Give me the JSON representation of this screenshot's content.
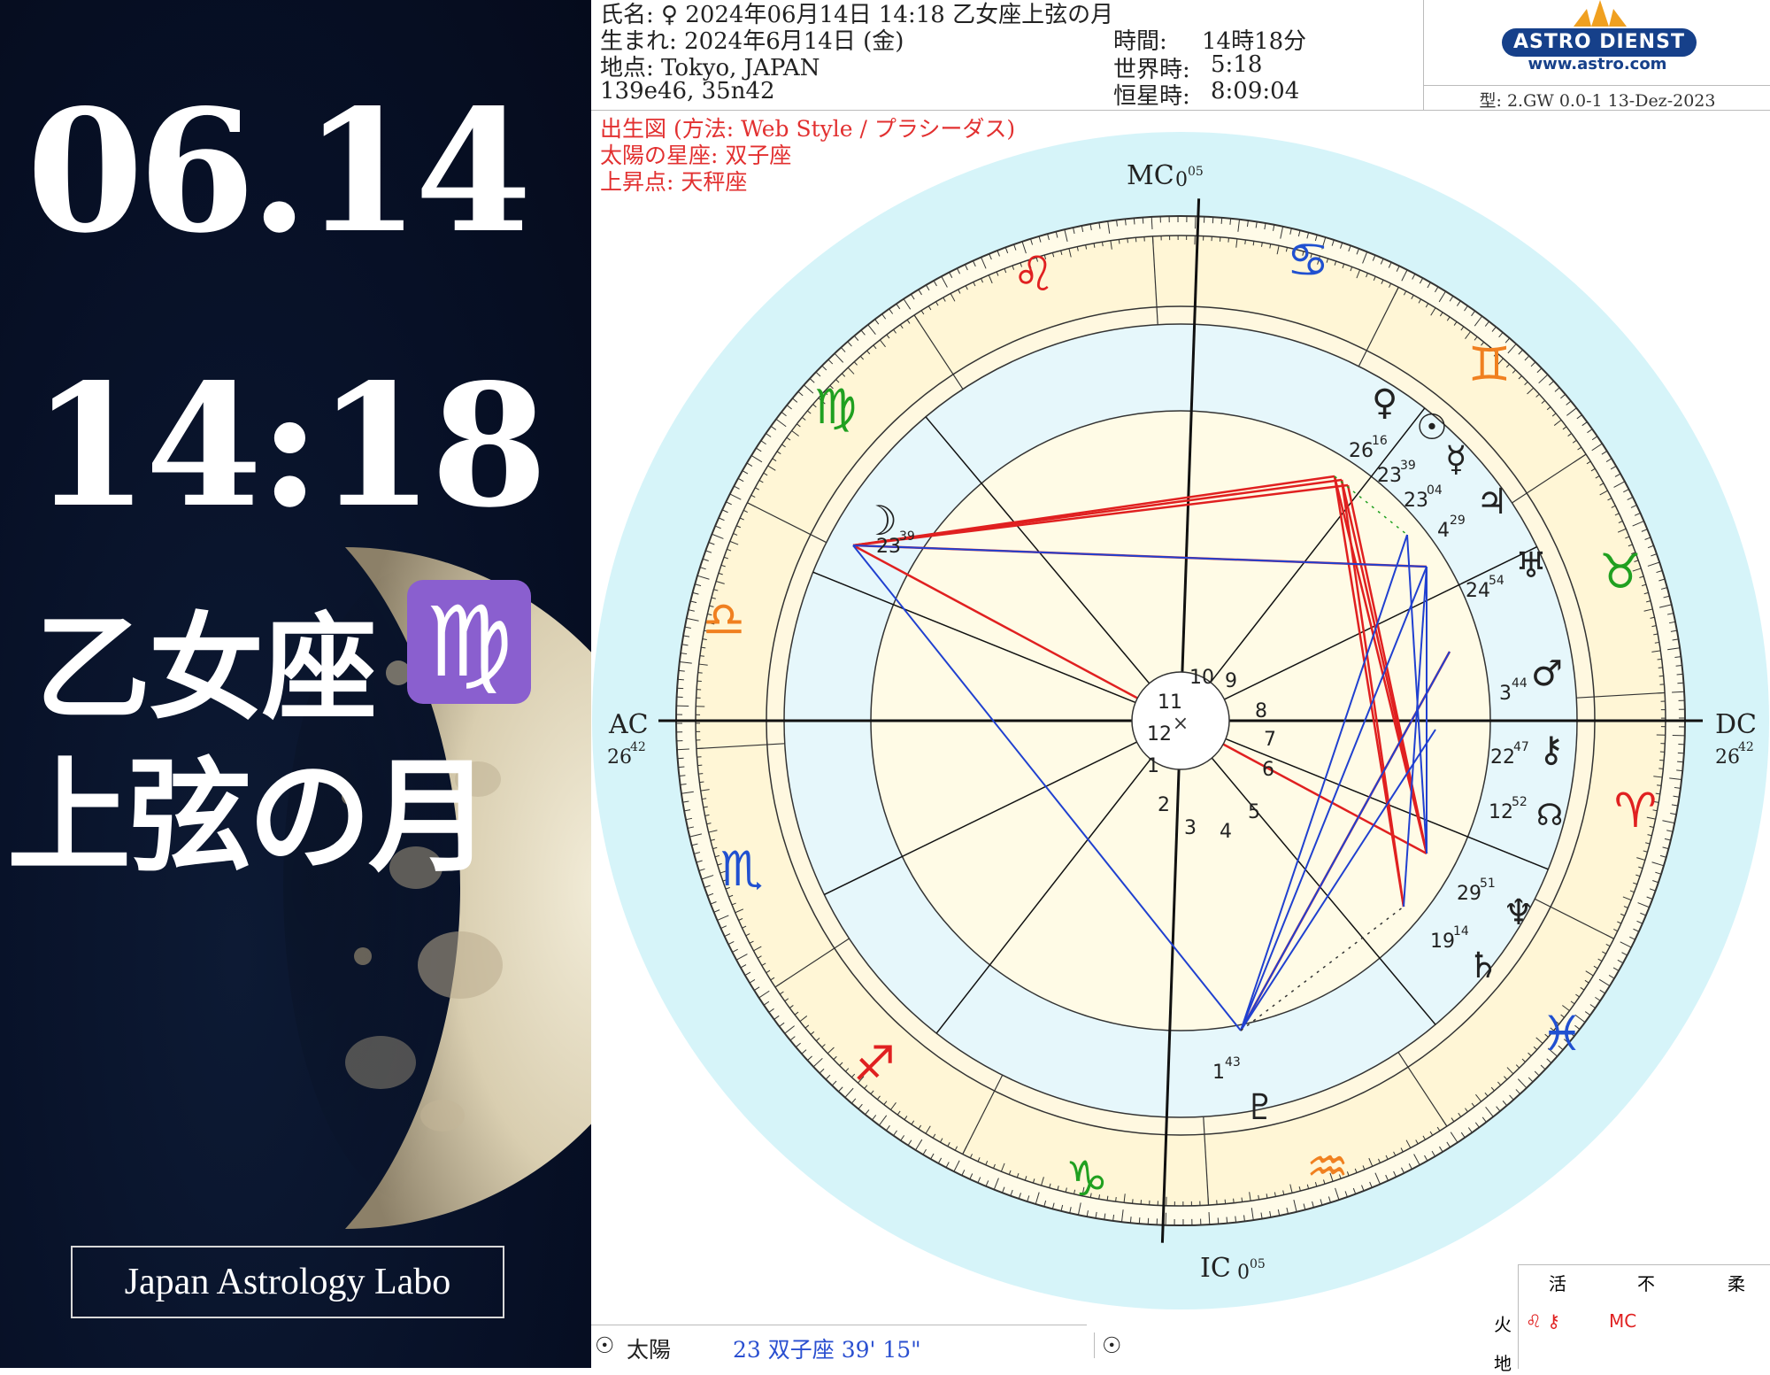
{
  "left_panel": {
    "date": "06.14",
    "time": "14:18",
    "sign": "乙女座",
    "sign_glyph": "♍",
    "phase": "上弦の月",
    "brand": "Japan Astrology Labo",
    "badge_color": "#8a5fcf"
  },
  "header": {
    "name": "氏名: ♀ 2024年06月14日 14:18 乙女座上弦の月",
    "born": "生まれ: 2024年6月14日 (金)",
    "place": "地点: Tokyo, JAPAN",
    "coords": "139e46, 35n42",
    "time_label": "時間:",
    "time_value": "14時18分",
    "ut_label": "世界時:",
    "ut_value": "5:18",
    "st_label": "恒星時:",
    "st_value": "8:09:04",
    "logo_text": "ASTRO DIENST",
    "logo_url": "www.astro.com",
    "type_line": "型: 2.GW   0.0-1   13-Dez-2023"
  },
  "notes": {
    "line1": "出生図  (方法: Web Style / プラシーダス)",
    "line2": "太陽の星座: 双子座",
    "line3": "上昇点: 天秤座"
  },
  "chart": {
    "mc_label": "MC",
    "mc_deg": "0",
    "mc_min": "05",
    "ic_label": "IC",
    "ic_deg": "0",
    "ic_min": "05",
    "ac_label": "AC",
    "ac_deg": "26",
    "ac_min": "42",
    "dc_label": "DC",
    "dc_deg": "26",
    "dc_min": "42",
    "house_numbers": [
      "1",
      "2",
      "3",
      "4",
      "5",
      "6",
      "7",
      "8",
      "9",
      "10",
      "11",
      "12"
    ],
    "center_mark": "×",
    "signs": {
      "leo": "♌",
      "cancer": "♋",
      "gemini": "♊",
      "taurus": "♉",
      "aries": "♈",
      "pisces": "♓",
      "aquarius": "♒",
      "capricorn": "♑",
      "sagittarius": "♐",
      "scorpio": "♏",
      "libra": "♎",
      "virgo": "♍"
    },
    "planets": [
      {
        "glyph": "☽",
        "deg": "23",
        "min": "39"
      },
      {
        "glyph": "♀",
        "deg": "26",
        "min": "16"
      },
      {
        "glyph": "☉",
        "deg": "23",
        "min": "39"
      },
      {
        "glyph": "☿",
        "deg": "23",
        "min": "04"
      },
      {
        "glyph": "♃",
        "deg": "4",
        "min": "29"
      },
      {
        "glyph": "♅",
        "deg": "24",
        "min": "54"
      },
      {
        "glyph": "♂",
        "deg": "3",
        "min": "44"
      },
      {
        "glyph": "⚷",
        "deg": "22",
        "min": "47"
      },
      {
        "glyph": "☊",
        "deg": "12",
        "min": "52"
      },
      {
        "glyph": "♆",
        "deg": "29",
        "min": "51"
      },
      {
        "glyph": "♄",
        "deg": "19",
        "min": "14"
      },
      {
        "glyph": "♇",
        "deg": "1",
        "min": "43"
      }
    ],
    "sign_colors": {
      "fire": "#e02020",
      "earth": "#20a020",
      "air": "#f08020",
      "water": "#2050d0"
    }
  },
  "bottom": {
    "sun_glyph": "☉",
    "sun_label": "太陽",
    "sun_value": "23 双子座 39' 15\"",
    "sun_glyph2": "☉"
  },
  "modes": {
    "h1": "活",
    "h2": "不",
    "h3": "柔",
    "row1_label": "火",
    "row1_c1": "♌ ⚷",
    "row1_c2": "MC",
    "row2_label": "地"
  }
}
